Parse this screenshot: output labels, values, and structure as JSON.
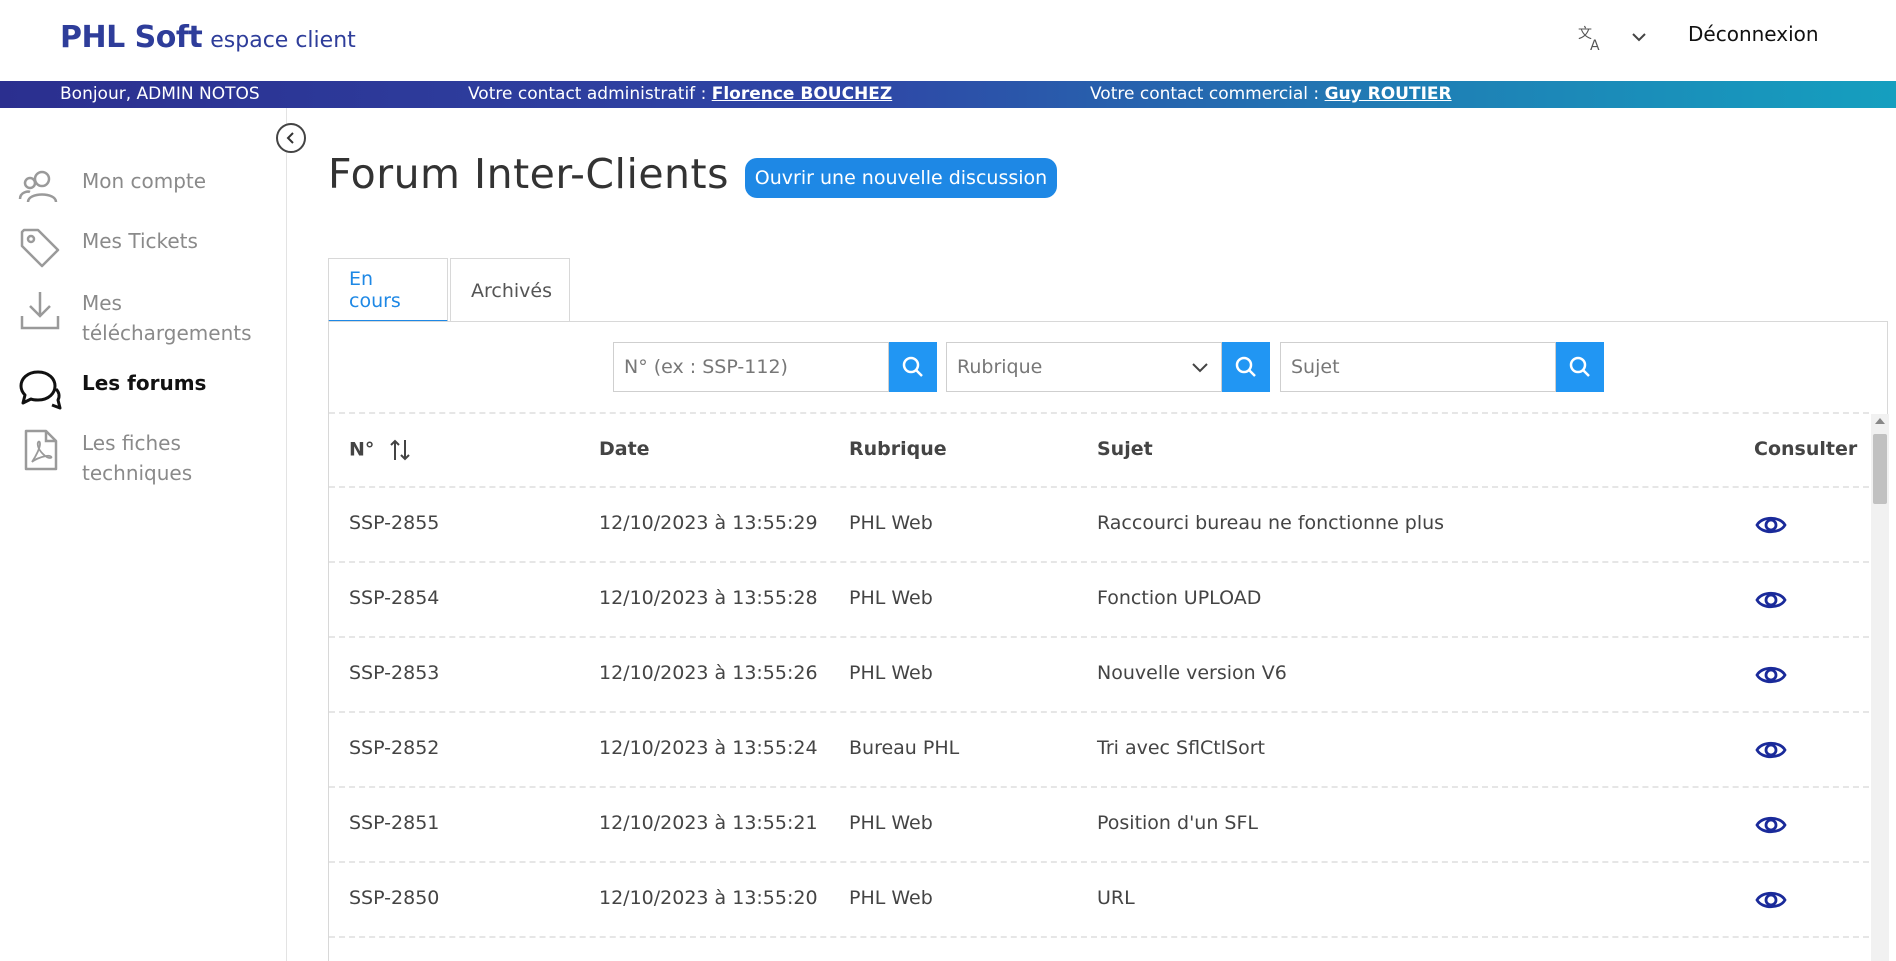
{
  "header": {
    "brand_name": "PHL Soft",
    "brand_sub": "espace client",
    "logout_label": "Déconnexion",
    "translate_icon": "translate-icon",
    "chevron_icon": "chevron-down-icon"
  },
  "infobar": {
    "greeting": "Bonjour, ADMIN NOTOS",
    "admin_prefix": "Votre contact administratif : ",
    "admin_name": "Florence BOUCHEZ",
    "commercial_prefix": "Votre contact commercial : ",
    "commercial_name": "Guy ROUTIER"
  },
  "sidebar": {
    "items": [
      {
        "label_lines": [
          "Mon compte"
        ],
        "icon": "users-icon",
        "active": false
      },
      {
        "label_lines": [
          "Mes Tickets"
        ],
        "icon": "tag-icon",
        "active": false
      },
      {
        "label_lines": [
          "Mes",
          "téléchargements"
        ],
        "icon": "download-icon",
        "active": false
      },
      {
        "label_lines": [
          "Les forums"
        ],
        "icon": "chat-icon",
        "active": true
      },
      {
        "label_lines": [
          "Les fiches",
          "techniques"
        ],
        "icon": "pdf-file-icon",
        "active": false
      }
    ]
  },
  "main": {
    "title": "Forum Inter-Clients",
    "new_button_label": "Ouvrir une nouvelle discussion",
    "tabs": [
      {
        "label": "En cours",
        "active": true
      },
      {
        "label": "Archivés",
        "active": false
      }
    ],
    "filters": {
      "number_placeholder": "N° (ex : SSP-112)",
      "rubrique_selected": "Rubrique",
      "sujet_placeholder": "Sujet"
    },
    "table": {
      "headers": {
        "no": "N°",
        "date": "Date",
        "rubrique": "Rubrique",
        "sujet": "Sujet",
        "consulter": "Consulter"
      },
      "rows": [
        {
          "no": "SSP-2855",
          "date": "12/10/2023 à 13:55:29",
          "rubrique": "PHL Web",
          "sujet": "Raccourci bureau ne fonctionne plus"
        },
        {
          "no": "SSP-2854",
          "date": "12/10/2023 à 13:55:28",
          "rubrique": "PHL Web",
          "sujet": "Fonction UPLOAD"
        },
        {
          "no": "SSP-2853",
          "date": "12/10/2023 à 13:55:26",
          "rubrique": "PHL Web",
          "sujet": "Nouvelle version V6"
        },
        {
          "no": "SSP-2852",
          "date": "12/10/2023 à 13:55:24",
          "rubrique": "Bureau PHL",
          "sujet": "Tri avec SflCtlSort"
        },
        {
          "no": "SSP-2851",
          "date": "12/10/2023 à 13:55:21",
          "rubrique": "PHL Web",
          "sujet": "Position d'un SFL"
        },
        {
          "no": "SSP-2850",
          "date": "12/10/2023 à 13:55:20",
          "rubrique": "PHL Web",
          "sujet": "URL"
        }
      ]
    }
  },
  "colors": {
    "brand": "#2e3d9a",
    "accent": "#1e88e5",
    "eye_icon": "#1a2a9a"
  }
}
